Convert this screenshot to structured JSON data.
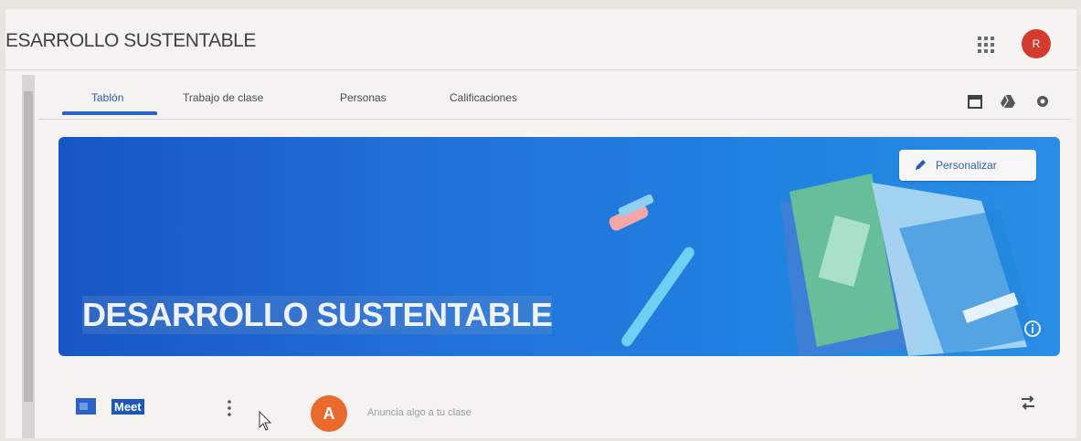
{
  "topbar": {
    "class_title": "ESARROLLO SUSTENTABLE",
    "user_initial": "R"
  },
  "tabs": [
    {
      "label": "Tablón"
    },
    {
      "label": "Trabajo de clase"
    },
    {
      "label": "Personas"
    },
    {
      "label": "Calificaciones"
    }
  ],
  "toolbar_icons": [
    "calendar-icon",
    "drive-icon",
    "settings-icon"
  ],
  "banner": {
    "title": "DESARROLLO SUSTENTABLE",
    "customize_label": "Personalizar"
  },
  "stream": {
    "meet_label": "Meet",
    "author_initial": "A",
    "announce_placeholder": "Anuncia algo a tu clase"
  },
  "colors": {
    "accent": "#2a62c6",
    "banner": "#1f6fd6",
    "avatar_top": "#d43b2e",
    "avatar_post": "#e96a2c"
  }
}
